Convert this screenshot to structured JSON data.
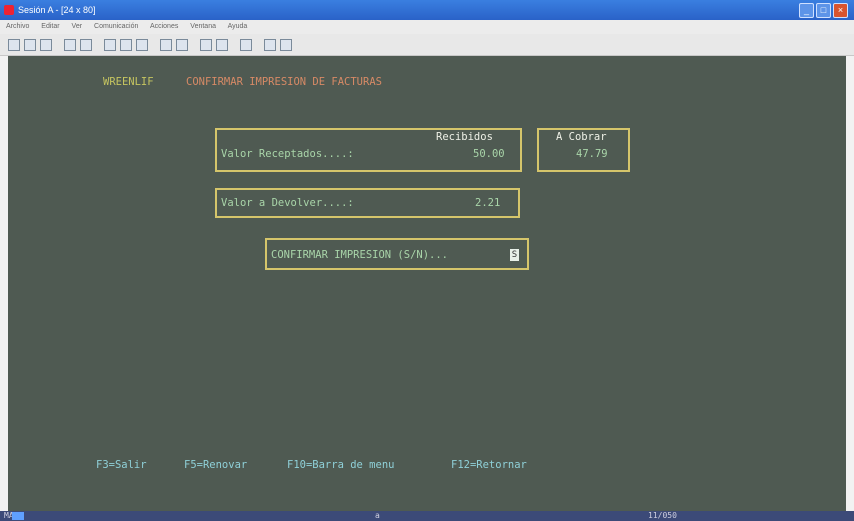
{
  "window": {
    "title": "Sesión A - [24 x 80]",
    "menu": [
      "Archivo",
      "Editar",
      "Ver",
      "Comunicación",
      "Acciones",
      "Ventana",
      "Ayuda"
    ]
  },
  "screen": {
    "program_name": "WREENLIF",
    "heading": "CONFIRMAR IMPRESION DE FACTURAS",
    "recibidos_header": "Recibidos",
    "valor_receptados_label": "Valor Receptados....:",
    "valor_receptados_value": "50.00",
    "a_cobrar_header": "A Cobrar",
    "a_cobrar_value": "47.79",
    "valor_devolver_label": "Valor a Devolver....:",
    "valor_devolver_value": "2.21",
    "confirm_prompt": "CONFIRMAR IMPRESION (S/N)...",
    "confirm_input_value": "S",
    "fkeys": [
      "F3=Salir",
      "F5=Renovar",
      "F10=Barra de menu",
      "F12=Retornar"
    ]
  },
  "status": {
    "indicator": "MA",
    "mid": "a",
    "cursor_pos": "11/050"
  },
  "colors": {
    "terminal_bg": "#4f5a52",
    "box_border": "#d5c56b",
    "heading": "#d78a66",
    "field_text": "#a9d5a9",
    "fkey_text": "#8fd0d8"
  }
}
